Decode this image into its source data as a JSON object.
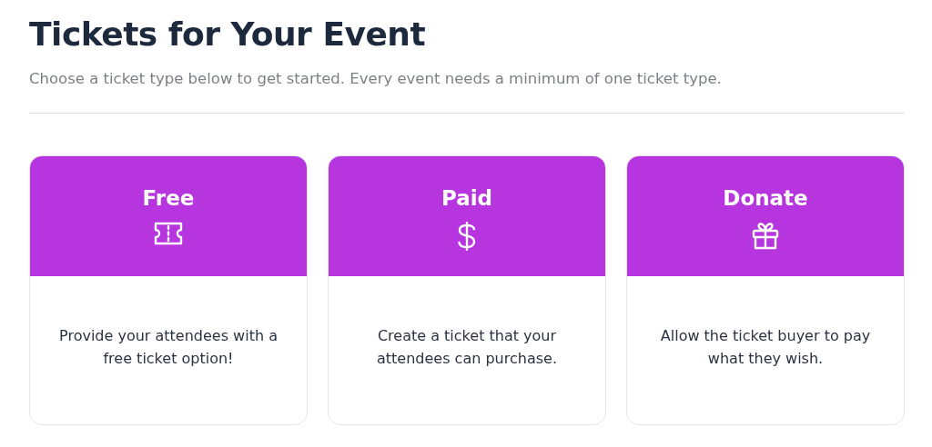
{
  "page": {
    "title": "Tickets for Your Event",
    "subtitle": "Choose a ticket type below to get started. Every event needs a minimum of one ticket type."
  },
  "ticket_types": [
    {
      "kind": "free",
      "title": "Free",
      "description": "Provide your attendees with a free ticket option!"
    },
    {
      "kind": "paid",
      "title": "Paid",
      "description": "Create a ticket that your attendees can purchase."
    },
    {
      "kind": "donate",
      "title": "Donate",
      "description": "Allow the ticket buyer to pay what they wish."
    }
  ]
}
